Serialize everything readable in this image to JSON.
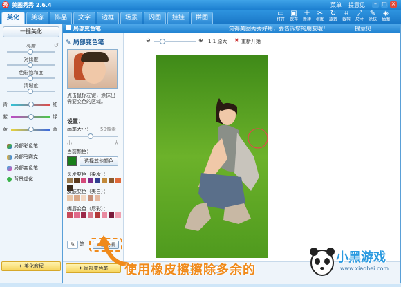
{
  "app": {
    "title": "美图秀秀 2.6.4",
    "menu": "菜单",
    "feedback": "提意见"
  },
  "nav": {
    "tabs": [
      "美化",
      "美容",
      "饰品",
      "文字",
      "边框",
      "场景",
      "闪图",
      "娃娃",
      "拼图"
    ],
    "active": "美化"
  },
  "toolbar": {
    "tools": [
      {
        "label": "打开",
        "icon": "folder-icon"
      },
      {
        "label": "保存",
        "icon": "save-icon"
      },
      {
        "label": "新建",
        "icon": "new-icon"
      },
      {
        "label": "抠图",
        "icon": "cutout-icon"
      },
      {
        "label": "旋转",
        "icon": "rotate-icon"
      },
      {
        "label": "裁剪",
        "icon": "crop-icon"
      },
      {
        "label": "尺寸",
        "icon": "resize-icon"
      },
      {
        "label": "涂抹",
        "icon": "smudge-icon"
      },
      {
        "label": "抽图",
        "icon": "extract-icon"
      }
    ]
  },
  "left_panel": {
    "reset_button": "一键美化",
    "adjustments": [
      "亮度",
      "对比度",
      "色彩饱和度",
      "清晰度"
    ],
    "rgb": [
      {
        "left": "青",
        "right": "红"
      },
      {
        "left": "紫",
        "right": "绿"
      },
      {
        "left": "黄",
        "right": "蓝"
      }
    ],
    "tools": [
      "局部彩色笔",
      "局部马赛克",
      "局部变色笔",
      "背景虚化"
    ],
    "tutorial_button": "美化教程"
  },
  "popup": {
    "title": "局部变色笔",
    "message": "觉得美图秀秀好用，要告诉您的朋友哦！",
    "feedback": "提意见",
    "tool_name": "局部变色笔",
    "instructions": "点击鼠标左键，涂抹出需要变色的区域。",
    "settings": "设置：",
    "brush_size_label": "画笔大小：",
    "brush_size_value": "50像素",
    "size_small": "小",
    "size_large": "大",
    "current_color_label": "当前颜色：",
    "choose_color_button": "选择其他颜色",
    "hair_label": "头发变色（染发）：",
    "skin_label": "皮肤变色（美白）：",
    "lips_label": "嘴唇变色（唇彩）：",
    "eraser_button": "橡皮擦",
    "pen_button": "笔",
    "bottom_tab": "局部变色笔",
    "canvas": {
      "zoom_label": "1:1 原大",
      "restart_label": "重新开始"
    }
  },
  "caption": "使用橡皮擦擦除多余的",
  "watermark": {
    "brand": "小黑游戏",
    "url": "www.xiaohei.com"
  },
  "colors": {
    "current": "#1a7f1a",
    "hair_swatches": [
      "#9a7b4f",
      "#5a3a1e",
      "#d44a7a",
      "#7b2d8b",
      "#2f3f8f",
      "#c28a3a",
      "#8b5a2b",
      "#e06a3a",
      "#3a2a1a"
    ],
    "skin_swatches": [
      "#e8c6a8",
      "#d9a887",
      "#f2d7c3",
      "#c7907a",
      "#e4b9a2"
    ],
    "lip_swatches": [
      "#c84a5a",
      "#e06a8a",
      "#9c2a4a",
      "#d8788a",
      "#b33a3a",
      "#e98aa0",
      "#7a1a3a",
      "#f0a0b0"
    ]
  }
}
